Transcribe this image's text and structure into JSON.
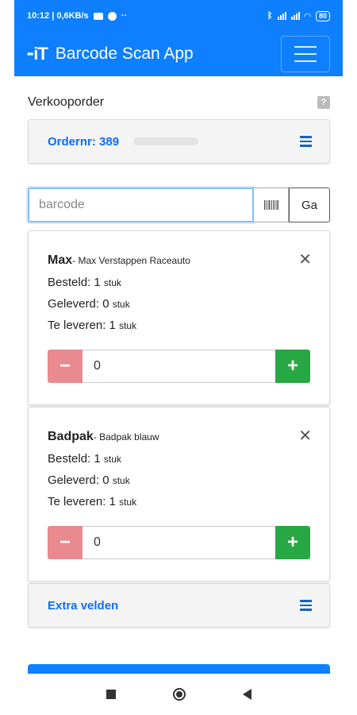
{
  "status_bar": {
    "time": "10:12 | 0,6KB/s",
    "dots": "··",
    "battery": "80"
  },
  "app": {
    "logo": "iT",
    "title": "Barcode Scan App"
  },
  "section": {
    "title": "Verkooporder",
    "help_label": "?"
  },
  "order": {
    "label": "Ordernr: 389"
  },
  "barcode": {
    "placeholder": "barcode",
    "go_label": "Ga"
  },
  "items": [
    {
      "name": "Max",
      "description": "- Max Verstappen Raceauto",
      "ordered_label": "Besteld: 1",
      "delivered_label": "Geleverd: 0",
      "to_deliver_label": "Te leveren: 1",
      "unit": "stuk",
      "quantity": "0",
      "minus": "−",
      "plus": "+",
      "close": "✕"
    },
    {
      "name": "Badpak",
      "description": "- Badpak blauw",
      "ordered_label": "Besteld: 1",
      "delivered_label": "Geleverd: 0",
      "to_deliver_label": "Te leveren: 1",
      "unit": "stuk",
      "quantity": "0",
      "minus": "−",
      "plus": "+",
      "close": "✕"
    }
  ],
  "extra": {
    "label": "Extra velden"
  },
  "colors": {
    "primary": "#0d7fff",
    "link": "#0d6efd",
    "danger": "#e88a8f",
    "success": "#28a745"
  }
}
